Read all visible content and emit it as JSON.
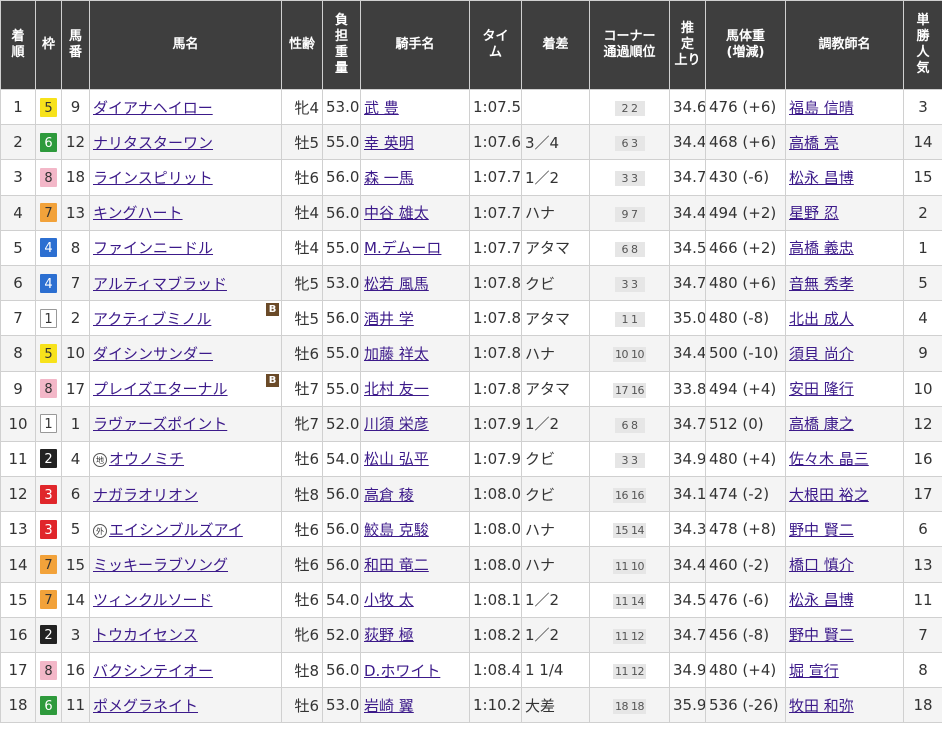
{
  "headers": {
    "rank": [
      "着",
      "順"
    ],
    "frame": [
      "枠"
    ],
    "number": [
      "馬",
      "番"
    ],
    "horse": [
      "馬名"
    ],
    "sex_age": [
      "性齢"
    ],
    "weight_carried": [
      "負",
      "担",
      "重",
      "量"
    ],
    "jockey": [
      "騎手名"
    ],
    "time": [
      "タイ",
      "ム"
    ],
    "margin": [
      "着差"
    ],
    "corner": [
      "コーナー",
      "通過順位"
    ],
    "last3f": [
      "推",
      "定",
      "上り"
    ],
    "body_weight": [
      "馬体重",
      "(増減)"
    ],
    "trainer": [
      "調教師名"
    ],
    "popularity": [
      "単",
      "勝",
      "人",
      "気"
    ]
  },
  "frame_colors": {
    "1": {
      "bg": "#ffffff",
      "fg": "#333333",
      "border": "#999999"
    },
    "2": {
      "bg": "#222222",
      "fg": "#ffffff",
      "border": "#222222"
    },
    "3": {
      "bg": "#e0262b",
      "fg": "#ffffff",
      "border": "#e0262b"
    },
    "4": {
      "bg": "#2c6fd1",
      "fg": "#ffffff",
      "border": "#2c6fd1"
    },
    "5": {
      "bg": "#f7e21b",
      "fg": "#333333",
      "border": "#f7e21b"
    },
    "6": {
      "bg": "#2e9a3c",
      "fg": "#ffffff",
      "border": "#2e9a3c"
    },
    "7": {
      "bg": "#f2a23a",
      "fg": "#333333",
      "border": "#f2a23a"
    },
    "8": {
      "bg": "#f3b7c8",
      "fg": "#333333",
      "border": "#f3b7c8"
    }
  },
  "rows": [
    {
      "rank": "1",
      "frame": "5",
      "number": "9",
      "horse": "ダイアナヘイロー",
      "mark": "",
      "blinker": "",
      "sex_age": "牝4",
      "weight_carried": "53.0",
      "jockey": "武 豊",
      "time": "1:07.5",
      "margin": "",
      "corner": [
        "2",
        "2"
      ],
      "last3f": "34.6",
      "body_weight": "476 (+6)",
      "trainer": "福島 信晴",
      "popularity": "3"
    },
    {
      "rank": "2",
      "frame": "6",
      "number": "12",
      "horse": "ナリタスターワン",
      "mark": "",
      "blinker": "",
      "sex_age": "牡5",
      "weight_carried": "55.0",
      "jockey": "幸 英明",
      "time": "1:07.6",
      "margin": "3／4",
      "corner": [
        "6",
        "3"
      ],
      "last3f": "34.4",
      "body_weight": "468 (+6)",
      "trainer": "高橋 亮",
      "popularity": "14"
    },
    {
      "rank": "3",
      "frame": "8",
      "number": "18",
      "horse": "ラインスピリット",
      "mark": "",
      "blinker": "",
      "sex_age": "牡6",
      "weight_carried": "56.0",
      "jockey": "森 一馬",
      "time": "1:07.7",
      "margin": "1／2",
      "corner": [
        "3",
        "3"
      ],
      "last3f": "34.7",
      "body_weight": "430 (-6)",
      "trainer": "松永 昌博",
      "popularity": "15"
    },
    {
      "rank": "4",
      "frame": "7",
      "number": "13",
      "horse": "キングハート",
      "mark": "",
      "blinker": "",
      "sex_age": "牡4",
      "weight_carried": "56.0",
      "jockey": "中谷 雄太",
      "time": "1:07.7",
      "margin": "ハナ",
      "corner": [
        "9",
        "7"
      ],
      "last3f": "34.4",
      "body_weight": "494 (+2)",
      "trainer": "星野 忍",
      "popularity": "2"
    },
    {
      "rank": "5",
      "frame": "4",
      "number": "8",
      "horse": "ファインニードル",
      "mark": "",
      "blinker": "",
      "sex_age": "牡4",
      "weight_carried": "55.0",
      "jockey": "M.デムーロ",
      "time": "1:07.7",
      "margin": "アタマ",
      "corner": [
        "6",
        "8"
      ],
      "last3f": "34.5",
      "body_weight": "466 (+2)",
      "trainer": "高橋 義忠",
      "popularity": "1"
    },
    {
      "rank": "6",
      "frame": "4",
      "number": "7",
      "horse": "アルティマブラッド",
      "mark": "",
      "blinker": "",
      "sex_age": "牝5",
      "weight_carried": "53.0",
      "jockey": "松若 風馬",
      "time": "1:07.8",
      "margin": "クビ",
      "corner": [
        "3",
        "3"
      ],
      "last3f": "34.7",
      "body_weight": "480 (+6)",
      "trainer": "音無 秀孝",
      "popularity": "5"
    },
    {
      "rank": "7",
      "frame": "1",
      "number": "2",
      "horse": "アクティブミノル",
      "mark": "",
      "blinker": "B",
      "sex_age": "牡5",
      "weight_carried": "56.0",
      "jockey": "酒井 学",
      "time": "1:07.8",
      "margin": "アタマ",
      "corner": [
        "1",
        "1"
      ],
      "last3f": "35.0",
      "body_weight": "480 (-8)",
      "trainer": "北出 成人",
      "popularity": "4"
    },
    {
      "rank": "8",
      "frame": "5",
      "number": "10",
      "horse": "ダイシンサンダー",
      "mark": "",
      "blinker": "",
      "sex_age": "牡6",
      "weight_carried": "55.0",
      "jockey": "加藤 祥太",
      "time": "1:07.8",
      "margin": "ハナ",
      "corner": [
        "10",
        "10"
      ],
      "last3f": "34.4",
      "body_weight": "500 (-10)",
      "trainer": "須貝 尚介",
      "popularity": "9"
    },
    {
      "rank": "9",
      "frame": "8",
      "number": "17",
      "horse": "プレイズエターナル",
      "mark": "",
      "blinker": "B",
      "sex_age": "牡7",
      "weight_carried": "55.0",
      "jockey": "北村 友一",
      "time": "1:07.8",
      "margin": "アタマ",
      "corner": [
        "17",
        "16"
      ],
      "last3f": "33.8",
      "body_weight": "494 (+4)",
      "trainer": "安田 隆行",
      "popularity": "10"
    },
    {
      "rank": "10",
      "frame": "1",
      "number": "1",
      "horse": "ラヴァーズポイント",
      "mark": "",
      "blinker": "",
      "sex_age": "牝7",
      "weight_carried": "52.0",
      "jockey": "川須 栄彦",
      "time": "1:07.9",
      "margin": "1／2",
      "corner": [
        "6",
        "8"
      ],
      "last3f": "34.7",
      "body_weight": "512 (0)",
      "trainer": "高橋 康之",
      "popularity": "12"
    },
    {
      "rank": "11",
      "frame": "2",
      "number": "4",
      "horse": "オウノミチ",
      "mark": "地",
      "blinker": "",
      "sex_age": "牡6",
      "weight_carried": "54.0",
      "jockey": "松山 弘平",
      "time": "1:07.9",
      "margin": "クビ",
      "corner": [
        "3",
        "3"
      ],
      "last3f": "34.9",
      "body_weight": "480 (+4)",
      "trainer": "佐々木 晶三",
      "popularity": "16"
    },
    {
      "rank": "12",
      "frame": "3",
      "number": "6",
      "horse": "ナガラオリオン",
      "mark": "",
      "blinker": "",
      "sex_age": "牡8",
      "weight_carried": "56.0",
      "jockey": "高倉 稜",
      "time": "1:08.0",
      "margin": "クビ",
      "corner": [
        "16",
        "16"
      ],
      "last3f": "34.1",
      "body_weight": "474 (-2)",
      "trainer": "大根田 裕之",
      "popularity": "17"
    },
    {
      "rank": "13",
      "frame": "3",
      "number": "5",
      "horse": "エイシンブルズアイ",
      "mark": "外",
      "blinker": "",
      "sex_age": "牡6",
      "weight_carried": "56.0",
      "jockey": "鮫島 克駿",
      "time": "1:08.0",
      "margin": "ハナ",
      "corner": [
        "15",
        "14"
      ],
      "last3f": "34.3",
      "body_weight": "478 (+8)",
      "trainer": "野中 賢二",
      "popularity": "6"
    },
    {
      "rank": "14",
      "frame": "7",
      "number": "15",
      "horse": "ミッキーラブソング",
      "mark": "",
      "blinker": "",
      "sex_age": "牡6",
      "weight_carried": "56.0",
      "jockey": "和田 竜二",
      "time": "1:08.0",
      "margin": "ハナ",
      "corner": [
        "11",
        "10"
      ],
      "last3f": "34.4",
      "body_weight": "460 (-2)",
      "trainer": "橋口 慎介",
      "popularity": "13"
    },
    {
      "rank": "15",
      "frame": "7",
      "number": "14",
      "horse": "ツィンクルソード",
      "mark": "",
      "blinker": "",
      "sex_age": "牡6",
      "weight_carried": "54.0",
      "jockey": "小牧 太",
      "time": "1:08.1",
      "margin": "1／2",
      "corner": [
        "11",
        "14"
      ],
      "last3f": "34.5",
      "body_weight": "476 (-6)",
      "trainer": "松永 昌博",
      "popularity": "11"
    },
    {
      "rank": "16",
      "frame": "2",
      "number": "3",
      "horse": "トウカイセンス",
      "mark": "",
      "blinker": "",
      "sex_age": "牝6",
      "weight_carried": "52.0",
      "jockey": "荻野 極",
      "time": "1:08.2",
      "margin": "1／2",
      "corner": [
        "11",
        "12"
      ],
      "last3f": "34.7",
      "body_weight": "456 (-8)",
      "trainer": "野中 賢二",
      "popularity": "7"
    },
    {
      "rank": "17",
      "frame": "8",
      "number": "16",
      "horse": "バクシンテイオー",
      "mark": "",
      "blinker": "",
      "sex_age": "牡8",
      "weight_carried": "56.0",
      "jockey": "D.ホワイト",
      "time": "1:08.4",
      "margin": "1 1/4",
      "corner": [
        "11",
        "12"
      ],
      "last3f": "34.9",
      "body_weight": "480 (+4)",
      "trainer": "堀 宣行",
      "popularity": "8"
    },
    {
      "rank": "18",
      "frame": "6",
      "number": "11",
      "horse": "ポメグラネイト",
      "mark": "",
      "blinker": "",
      "sex_age": "牡6",
      "weight_carried": "53.0",
      "jockey": "岩崎 翼",
      "time": "1:10.2",
      "margin": "大差",
      "corner": [
        "18",
        "18"
      ],
      "last3f": "35.9",
      "body_weight": "536 (-26)",
      "trainer": "牧田 和弥",
      "popularity": "18"
    }
  ]
}
